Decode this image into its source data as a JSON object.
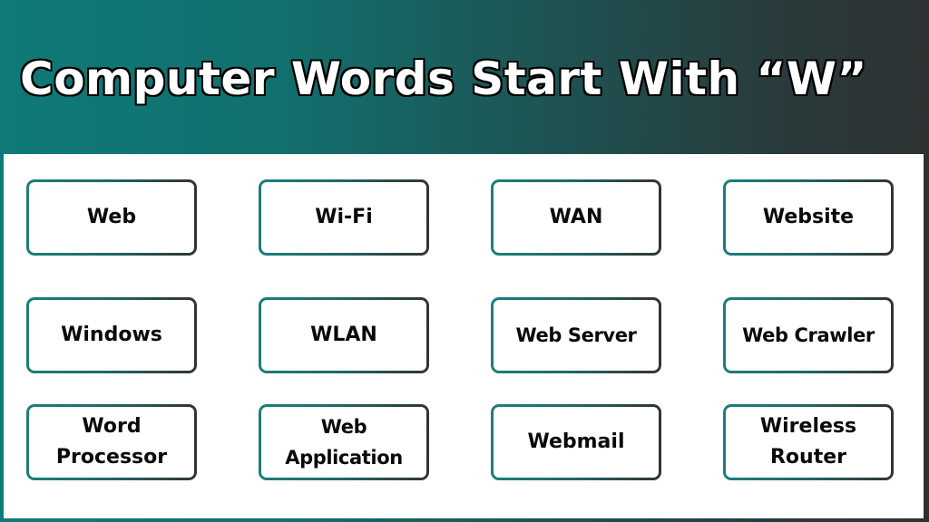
{
  "title": "Computer Words Start With “W”",
  "colors": {
    "frame_start": "#0f7a78",
    "frame_end": "#2e3233",
    "box_border_start": "#1b7f7c",
    "box_border_end": "#333333",
    "panel": "#ffffff",
    "text": "#0a0a0a"
  },
  "words": [
    {
      "label": "Web"
    },
    {
      "label": "Wi-Fi"
    },
    {
      "label": "WAN"
    },
    {
      "label": "Website"
    },
    {
      "label": "Windows"
    },
    {
      "label": "WLAN"
    },
    {
      "label": "Web Server"
    },
    {
      "label": "Web Crawler"
    },
    {
      "label": "Word\nProcessor"
    },
    {
      "label": "Web\nApplication"
    },
    {
      "label": "Webmail"
    },
    {
      "label": "Wireless\nRouter"
    }
  ]
}
